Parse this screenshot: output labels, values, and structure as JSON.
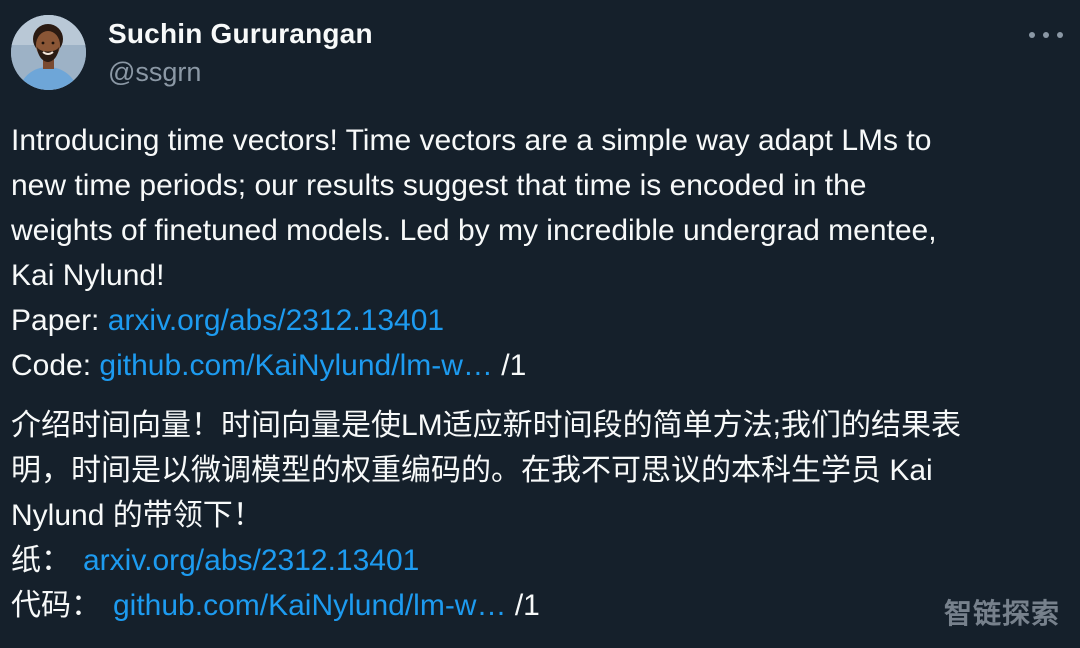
{
  "author": {
    "display_name": "Suchin Gururangan",
    "handle": "@ssgrn",
    "avatar_icon": "profile-photo"
  },
  "more_button": {
    "icon": "more-horizontal-icon"
  },
  "tweet": {
    "en": {
      "line1": "Introducing time vectors! Time vectors are a simple way adapt LMs to",
      "line2": "new time periods; our results suggest that time is encoded in the",
      "line3": "weights of finetuned models. Led by my incredible undergrad mentee,",
      "line4": "Kai Nylund!",
      "paper_label": "Paper:",
      "paper_link": "arxiv.org/abs/2312.13401",
      "code_label": "Code:",
      "code_link": "github.com/KaiNylund/lm-w…",
      "suffix": "/1"
    },
    "zh": {
      "line1": "介绍时间向量！时间向量是使LM适应新时间段的简单方法;我们的结果表",
      "line2": "明，时间是以微调模型的权重编码的。在我不可思议的本科生学员 Kai",
      "line3": "Nylund 的带领下！",
      "paper_label": "纸：",
      "paper_link": "arxiv.org/abs/2312.13401",
      "code_label": "代码：",
      "code_link": "github.com/KaiNylund/lm-w…",
      "suffix": "/1"
    }
  },
  "watermark": {
    "text": "智链探索"
  },
  "colors": {
    "background": "#15202b",
    "text": "#f7f9f9",
    "secondary": "#8b98a5",
    "link": "#1d9bf0"
  }
}
